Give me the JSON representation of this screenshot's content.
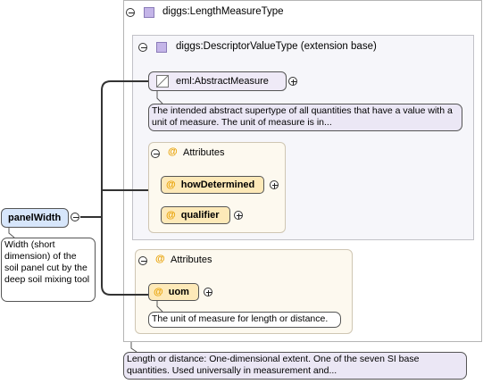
{
  "root_element": {
    "name": "panelWidth",
    "doc": "Width (short dimension) of the soil panel cut by the deep soil mixing tool"
  },
  "type": {
    "name": "diggs:LengthMeasureType",
    "doc": "Length or distance: One-dimensional extent. One of the seven SI base quantities. Used universally in measurement and...",
    "base": {
      "name": "diggs:DescriptorValueType (extension base)",
      "element": {
        "name": "eml:AbstractMeasure",
        "doc": "The intended abstract supertype of all quantities that have a value with a unit of measure. The unit of measure is in..."
      },
      "attributes": {
        "title": "Attributes",
        "items": [
          "howDetermined",
          "qualifier"
        ]
      }
    },
    "attributes": {
      "title": "Attributes",
      "items": [
        "uom"
      ],
      "uom_doc": "The unit of measure for length or distance."
    }
  },
  "icons": {
    "attribute_symbol": "@",
    "type_icon_color": "#c4b5e8",
    "attribute_fill": "#fde9b8",
    "element_fill": "#d7e6fb"
  }
}
